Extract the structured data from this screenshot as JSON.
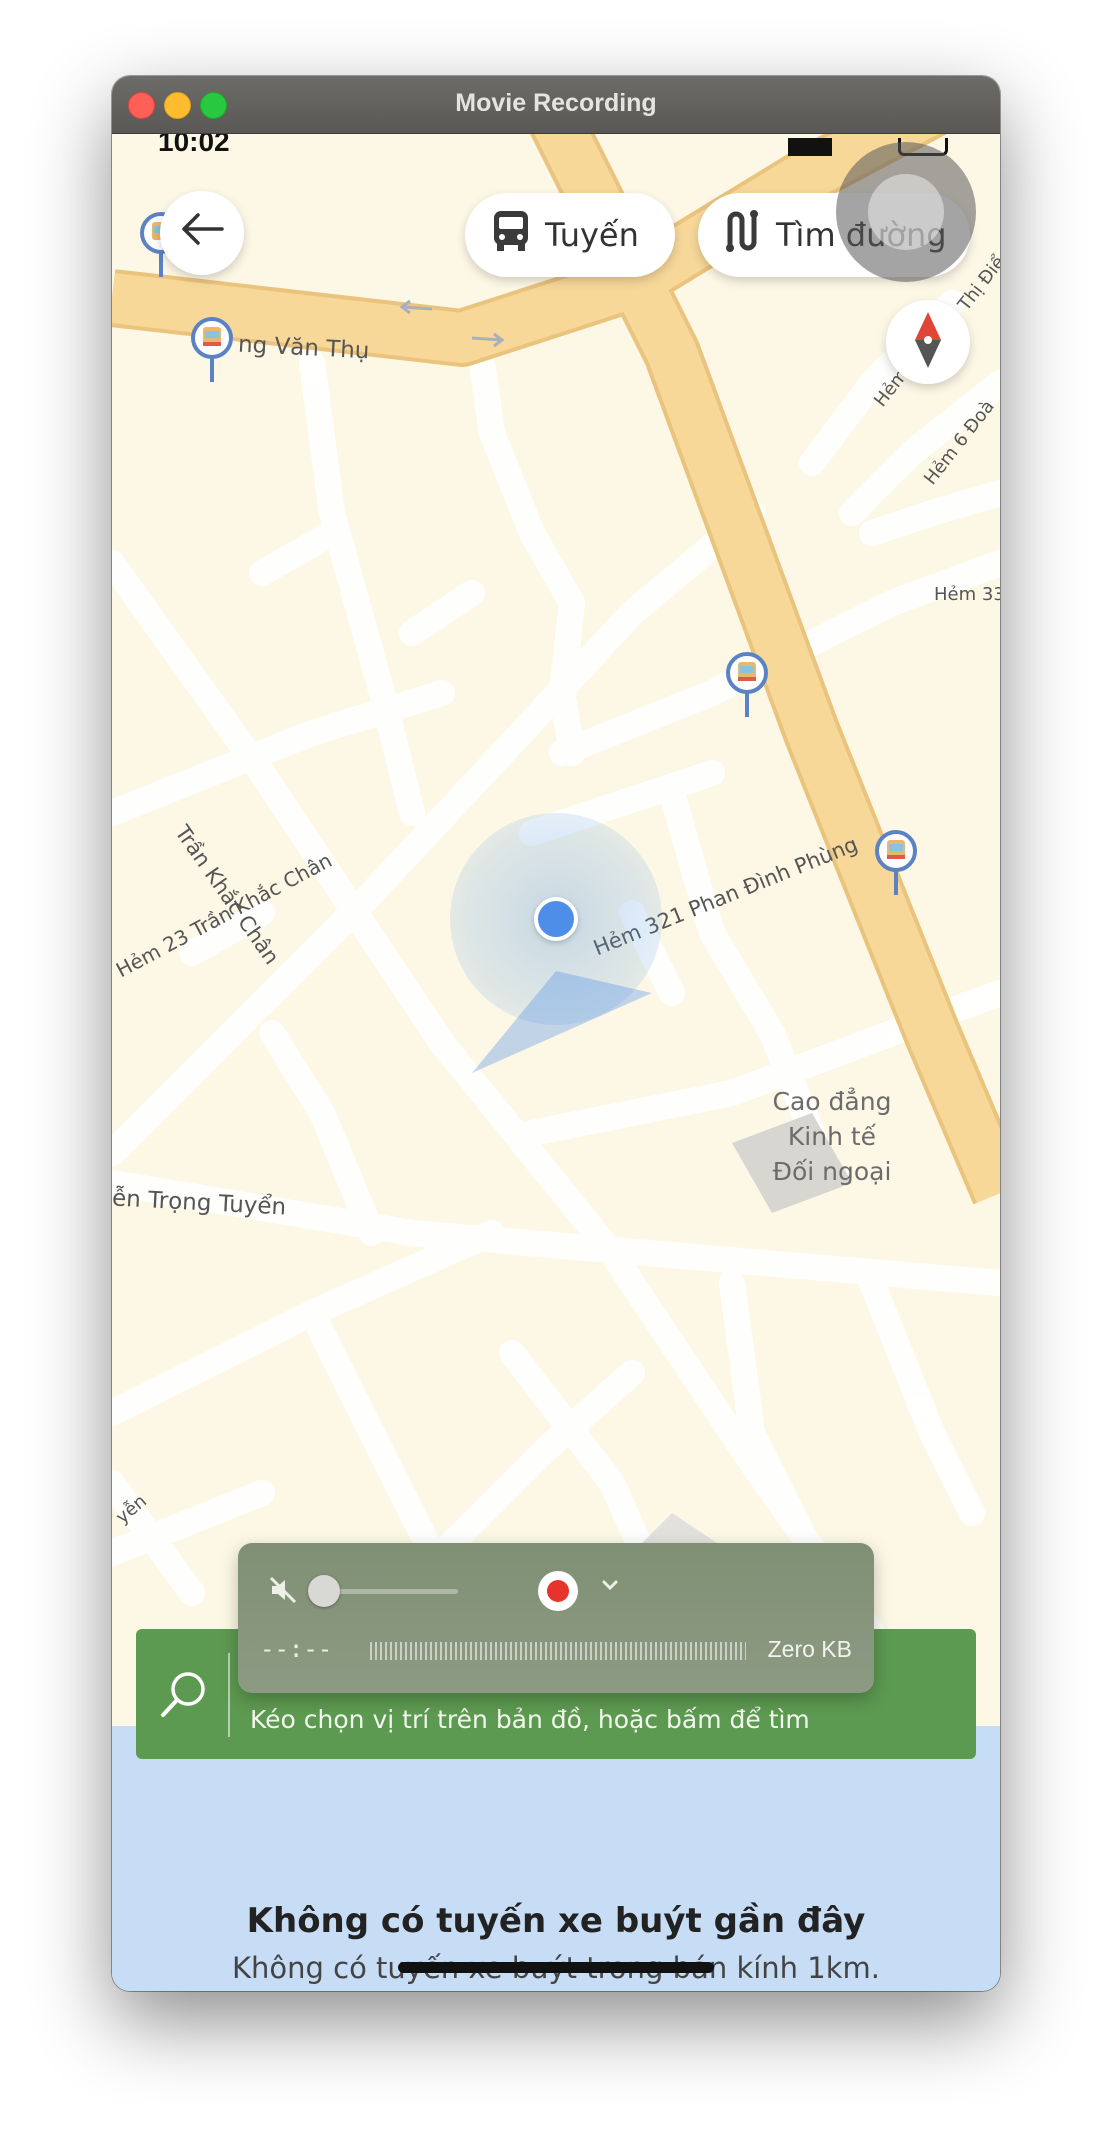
{
  "window": {
    "title": "Movie Recording"
  },
  "status_bar": {
    "time": "10:02"
  },
  "toolbar": {
    "route_label": "Tuyến",
    "directions_label": "Tìm đường"
  },
  "map": {
    "streets": [
      "ng Văn Thụ",
      "Trần Khắc Chân",
      "Hẻm 23 Trần Khắc Chân",
      "Hẻm 321 Phan Đình Phùng",
      "ễn Trọng Tuyển",
      "Thị Điể",
      "Hẻm",
      "Hẻm 6 Đoà",
      "Hẻm 33",
      "yễn"
    ],
    "place": [
      "Cao đẳng",
      "Kinh tế",
      "Đối ngoại"
    ]
  },
  "search": {
    "hint": "Kéo chọn vị trí trên bản đồ, hoặc bấm để tìm"
  },
  "recorder": {
    "time": "--:--",
    "size": "Zero KB",
    "volume_level": 0
  },
  "nearby": {
    "empty_title": "Không có tuyến xe buýt gần đây",
    "empty_subtitle": "Không có tuyến xe buýt trong bán kính 1km."
  },
  "colors": {
    "map_background": "#fdf8e6",
    "main_road": "#f7d899",
    "search_bar": "#5d9a51",
    "bottom_panel": "#c7ddf5",
    "location": "#4e8ee8",
    "record": "#e8332c"
  },
  "icons": [
    "back-arrow-icon",
    "bus-icon",
    "route-icon",
    "compass-icon",
    "bus-stop-icon",
    "search-icon",
    "mute-icon",
    "record-icon",
    "chevron-down-icon"
  ]
}
